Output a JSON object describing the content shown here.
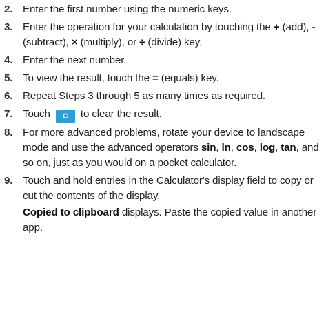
{
  "steps": [
    {
      "num": "2.",
      "parts": {
        "t1": "Enter the first number using the numeric keys."
      }
    },
    {
      "num": "3.",
      "parts": {
        "t1": "Enter the operation for your calculation by touching the ",
        "k1": "+",
        "t2": " (add), ",
        "k2": "-",
        "t3": " (subtract), ",
        "k3": "×",
        "t4": " (multiply), or ",
        "k4": "÷",
        "t5": " (divide) key."
      }
    },
    {
      "num": "4.",
      "parts": {
        "t1": "Enter the next number."
      }
    },
    {
      "num": "5.",
      "parts": {
        "t1": "To view the result, touch the ",
        "k1": "=",
        "t2": " (equals) key."
      }
    },
    {
      "num": "6.",
      "parts": {
        "t1": "Repeat Steps 3 through 5 as many times as required."
      }
    },
    {
      "num": "7.",
      "parts": {
        "t1": "Touch ",
        "key_label": "C",
        "t2": " to clear the result."
      }
    },
    {
      "num": "8.",
      "parts": {
        "t1": "For more advanced problems, rotate your device to landscape mode and use the advanced operators ",
        "k1": "sin",
        "t2": ", ",
        "k2": "ln",
        "t3": ", ",
        "k3": "cos",
        "t4": ", ",
        "k4": "log",
        "t5": ", ",
        "k5": "tan",
        "t6": ", and so on, just as you would on a pocket calculator."
      }
    },
    {
      "num": "9.",
      "parts": {
        "t1": "Touch and hold entries in the Calculator's display field to copy or cut the contents of the display.",
        "b1": "Copied to clipboard",
        "t2": " displays. Paste the copied value in another app."
      }
    }
  ],
  "colors": {
    "key_bg": "#2f9fd8",
    "text": "#222222"
  }
}
